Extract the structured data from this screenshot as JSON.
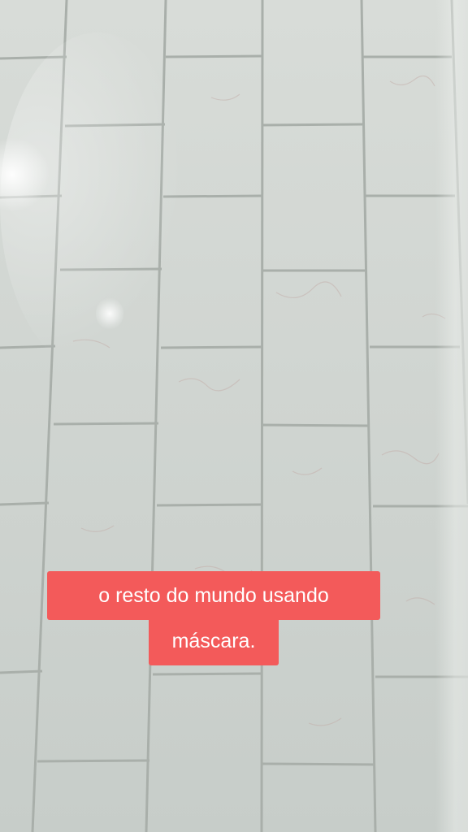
{
  "caption": {
    "line1": "o resto do mundo usando",
    "line2": "máscara."
  },
  "colors": {
    "caption_background": "#f35a5a",
    "caption_text": "#ffffff",
    "tile": "#d0d5d1",
    "grout": "#a8aea9"
  }
}
